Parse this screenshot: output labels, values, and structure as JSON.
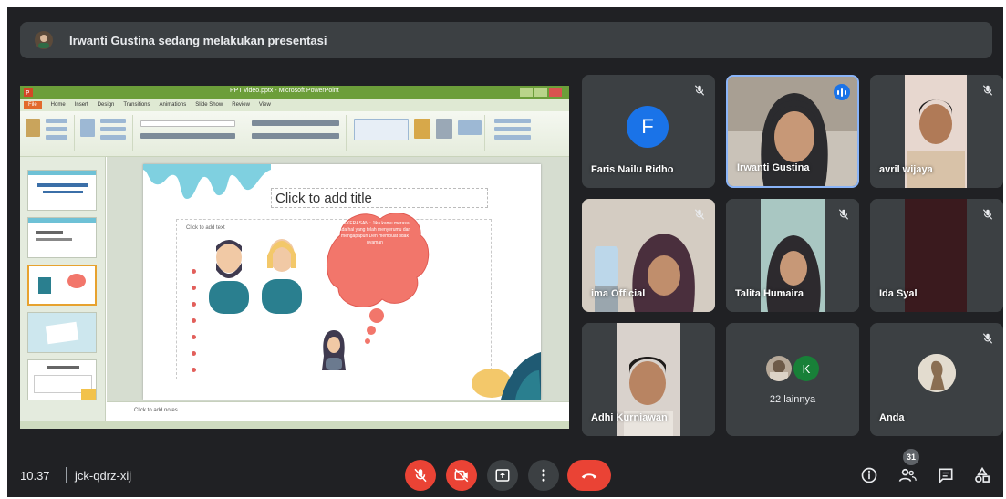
{
  "banner": {
    "text": "Irwanti Gustina sedang melakukan presentasi"
  },
  "presentation": {
    "window_title": "PPT video.pptx - Microsoft PowerPoint",
    "ribbon_tabs": [
      "File",
      "Home",
      "Insert",
      "Design",
      "Transitions",
      "Animations",
      "Slide Show",
      "Review",
      "View"
    ],
    "slide_title_placeholder": "Click to add title",
    "body_placeholder": "Click to add text",
    "speech_bubble_text": "KEKERASAN : Jika kamu merasa ada hal yang telah menyerumu dan mengapapun Den membuat tidak nyaman",
    "notes_placeholder": "Click to add notes"
  },
  "participants": [
    {
      "name": "Faris Nailu Ridho",
      "initial": "F",
      "avatar_color": "#1a73e8",
      "muted": true
    },
    {
      "name": "Irwanti Gustina",
      "speaking": true,
      "muted": false
    },
    {
      "name": "avril wijaya",
      "muted": true
    },
    {
      "name": "ima Official",
      "muted": true
    },
    {
      "name": "Talita Humaira",
      "muted": true
    },
    {
      "name": "Ida Syal",
      "muted": true
    },
    {
      "name": "Adhi Kurniawan",
      "muted": false
    },
    {
      "name": "22 lainnya",
      "initial": "K",
      "avatar_color": "#188038"
    },
    {
      "name": "Anda",
      "muted": true
    }
  ],
  "bottom_bar": {
    "time": "10.37",
    "meeting_code": "jck-qdrz-xij",
    "people_count": "31"
  },
  "colors": {
    "background": "#202124",
    "tile": "#3c4043",
    "danger": "#ea4335",
    "accent": "#8ab4f8"
  },
  "icons": {
    "mic_off": "mic-off-icon",
    "camera_off": "camera-off-icon",
    "present": "present-screen-icon",
    "more": "more-vert-icon",
    "end_call": "call-end-icon",
    "info": "info-icon",
    "people": "people-icon",
    "chat": "chat-icon",
    "activities": "activities-icon"
  }
}
